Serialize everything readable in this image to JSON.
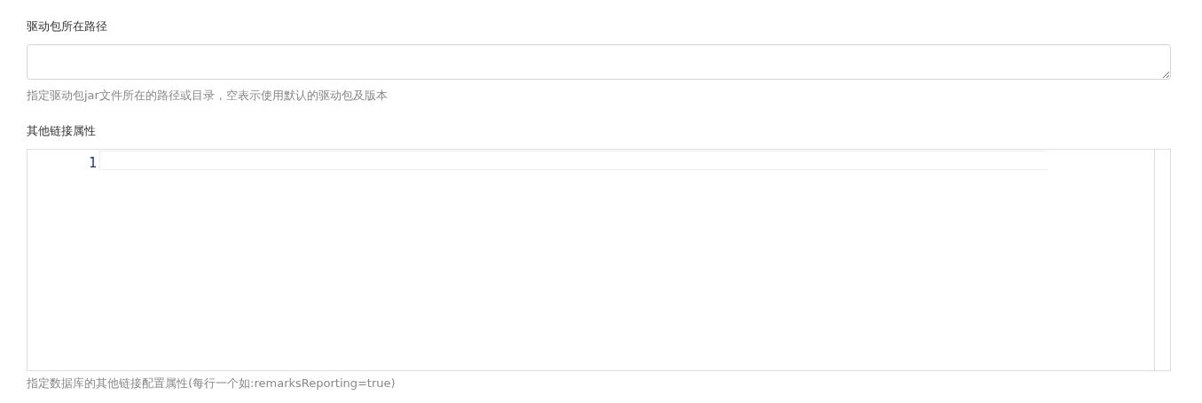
{
  "fields": [
    {
      "kind": "textarea",
      "label": "驱动包所在路径",
      "help": "指定驱动包jar文件所在的路径或目录，空表示使用默认的驱动包及版本"
    },
    {
      "kind": "code_editor",
      "label": "其他链接属性",
      "line_numbers": [
        "1"
      ],
      "help": "指定数据库的其他链接配置属性(每行一个如:remarksReporting=true)"
    }
  ]
}
